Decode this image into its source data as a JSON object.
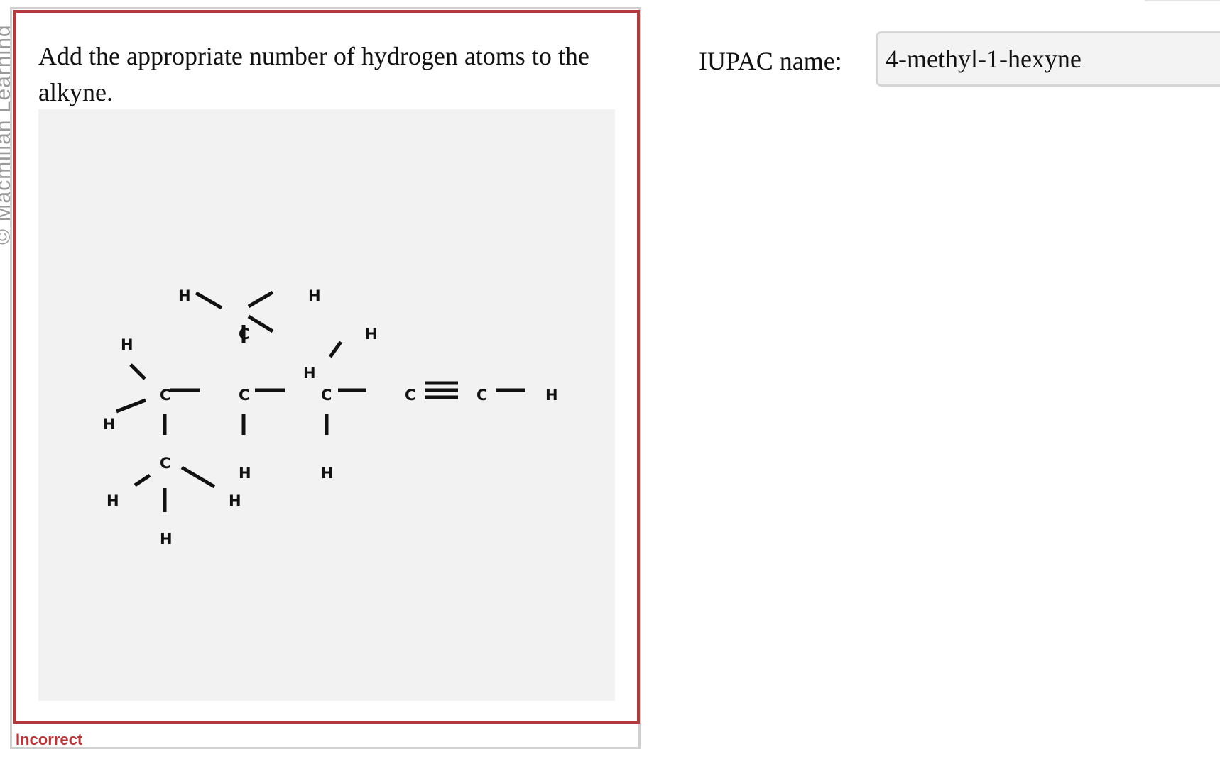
{
  "watermark": "© Macmillan Learning",
  "question": {
    "prompt": "Add the appropriate number of hydrogen atoms to the alkyne."
  },
  "molecule": {
    "carbon_symbol": "C",
    "hydrogen_symbol": "H"
  },
  "feedback": {
    "status": "Incorrect",
    "color": "#b5383c"
  },
  "answer": {
    "label": "IUPAC name:",
    "value": "4-methyl-1-hexyne"
  }
}
